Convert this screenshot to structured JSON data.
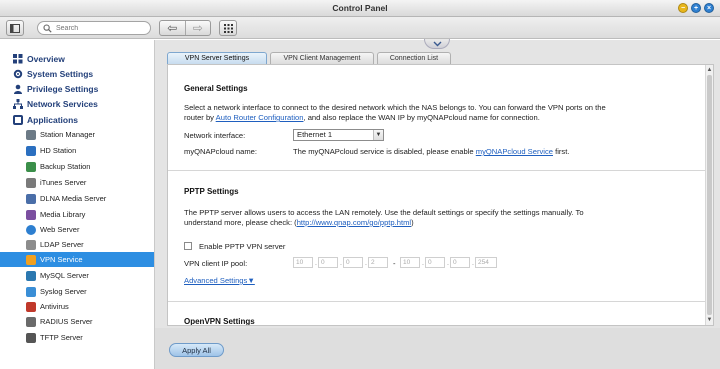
{
  "window": {
    "title": "Control Panel"
  },
  "toolbar": {
    "search_placeholder": "Search",
    "back": "⇦",
    "forward": "⇨"
  },
  "sidebar": {
    "categories": [
      {
        "label": "Overview",
        "icon": "overview-icon"
      },
      {
        "label": "System Settings",
        "icon": "gear-icon"
      },
      {
        "label": "Privilege Settings",
        "icon": "user-icon"
      },
      {
        "label": "Network Services",
        "icon": "network-icon"
      },
      {
        "label": "Applications",
        "icon": "applications-icon"
      }
    ],
    "apps": [
      {
        "label": "Station Manager",
        "color": "#6c7a86"
      },
      {
        "label": "HD Station",
        "color": "#2b6fc0"
      },
      {
        "label": "Backup Station",
        "color": "#3b8f4a"
      },
      {
        "label": "iTunes Server",
        "color": "#7a7a7a"
      },
      {
        "label": "DLNA Media Server",
        "color": "#4a6ea8"
      },
      {
        "label": "Media Library",
        "color": "#7b4fa0"
      },
      {
        "label": "Web Server",
        "color": "#2d7fd0"
      },
      {
        "label": "LDAP Server",
        "color": "#8c8c8c"
      },
      {
        "label": "VPN Service",
        "color": "#f0a020"
      },
      {
        "label": "MySQL Server",
        "color": "#2b78b0"
      },
      {
        "label": "Syslog Server",
        "color": "#3a8ed6"
      },
      {
        "label": "Antivirus",
        "color": "#c0392b"
      },
      {
        "label": "RADIUS Server",
        "color": "#6a6a6a"
      },
      {
        "label": "TFTP Server",
        "color": "#555555"
      }
    ],
    "active_app": "VPN Service"
  },
  "tabs": [
    "VPN Server Settings",
    "VPN Client Management",
    "Connection List"
  ],
  "general": {
    "title": "General Settings",
    "desc_1": "Select a network interface to connect to the desired network which the NAS belongs to. You can forward the VPN ports on the",
    "desc_2_pre": "router by ",
    "desc_2_link": "Auto Router Configuration",
    "desc_2_post": ", and also replace the WAN IP by myQNAPcloud name for connection.",
    "interface_label": "Network interface:",
    "interface_value": "Ethernet 1",
    "cloud_label": "myQNAPcloud name:",
    "cloud_text": "The myQNAPcloud service is disabled, please enable ",
    "cloud_link": "myQNAPcloud Service",
    "cloud_text_post": " first."
  },
  "pptp": {
    "title": "PPTP Settings",
    "desc_1": "The PPTP server allows users to access the LAN remotely. Use the default settings or specify the settings manually. To",
    "desc_2_pre": "understand more, please check: (",
    "desc_2_link": "http://www.qnap.com/go/pptp.html",
    "desc_2_post": ")",
    "enable_label": "Enable PPTP VPN server",
    "enabled": false,
    "pool_label": "VPN client IP pool:",
    "pool_start": [
      "10",
      "0",
      "0",
      "2"
    ],
    "pool_end": [
      "10",
      "0",
      "0",
      "254"
    ],
    "range_sep": "-",
    "advanced": "Advanced Settings▼"
  },
  "openvpn": {
    "title": "OpenVPN Settings"
  },
  "footer": {
    "apply": "Apply All"
  }
}
